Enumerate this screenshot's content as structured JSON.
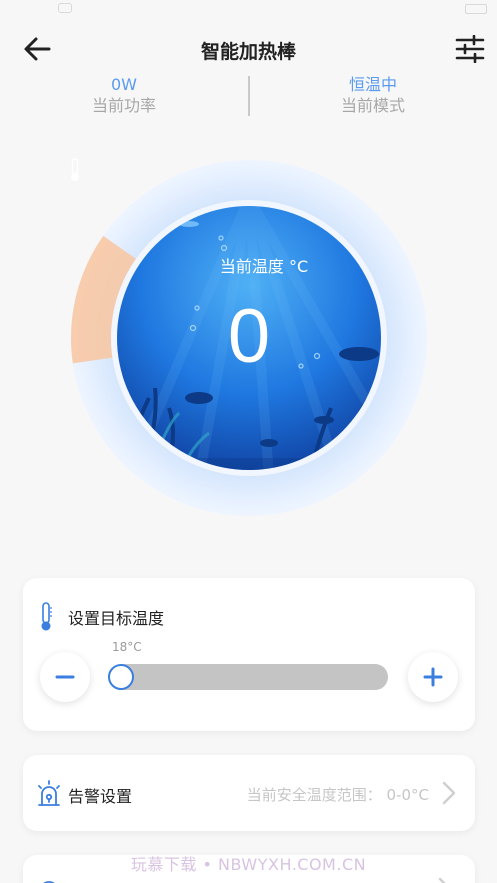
{
  "app": {
    "title": "智能加热棒"
  },
  "status_info": {
    "power_value": "0W",
    "power_label": "当前功率",
    "mode_value": "恒温中",
    "mode_label": "当前模式"
  },
  "gauge": {
    "label": "当前温度 °C",
    "current_temp": "0",
    "fill_fraction": 0.12,
    "track_color": "#e4efff",
    "fill_color": "#f9c6a0",
    "water_color": "#1f78e0"
  },
  "target_temp": {
    "title": "设置目标温度",
    "value_label": "18°C",
    "slider_fraction": 0
  },
  "alarm": {
    "title": "告警设置",
    "range_text": "当前安全温度范围：  0-0°C"
  },
  "watermark": "玩慕下载 • NBWYXH.COM.CN",
  "colors": {
    "accent": "#3a7fe0",
    "value_blue": "#5a9bf0",
    "muted": "#a8a8a8"
  },
  "icons": {
    "back": "arrow-left-icon",
    "settings": "sliders-icon",
    "thermometer": "thermometer-icon",
    "alarm": "alarm-light-icon",
    "minus": "minus-icon",
    "plus": "plus-icon",
    "chevron": "chevron-right-icon"
  }
}
